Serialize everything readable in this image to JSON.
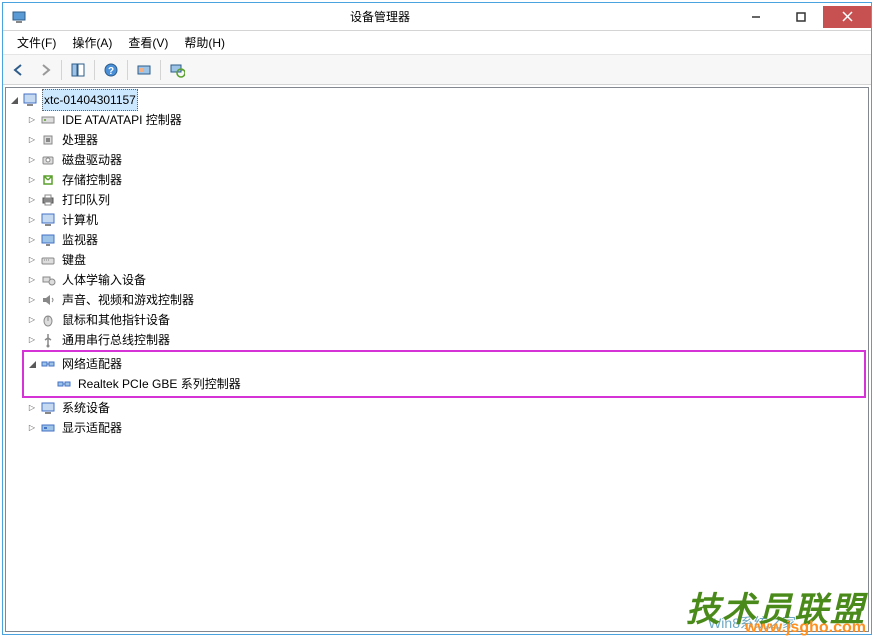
{
  "window": {
    "title": "设备管理器"
  },
  "menu": {
    "file": "文件(F)",
    "action": "操作(A)",
    "view": "查看(V)",
    "help": "帮助(H)"
  },
  "tree": {
    "root": "xtc-01404301157",
    "items": [
      {
        "label": "IDE ATA/ATAPI 控制器"
      },
      {
        "label": "处理器"
      },
      {
        "label": "磁盘驱动器"
      },
      {
        "label": "存储控制器"
      },
      {
        "label": "打印队列"
      },
      {
        "label": "计算机"
      },
      {
        "label": "监视器"
      },
      {
        "label": "键盘"
      },
      {
        "label": "人体学输入设备"
      },
      {
        "label": "声音、视频和游戏控制器"
      },
      {
        "label": "鼠标和其他指针设备"
      },
      {
        "label": "通用串行总线控制器"
      },
      {
        "label": "网络适配器",
        "expanded": true,
        "highlighted": true,
        "children": [
          {
            "label": "Realtek PCIe GBE 系列控制器"
          }
        ]
      },
      {
        "label": "系统设备"
      },
      {
        "label": "显示适配器"
      }
    ]
  },
  "watermarks": {
    "w1": "技术员联盟",
    "w2": "www.jsgho.com",
    "w3": "Win8系统之家"
  }
}
